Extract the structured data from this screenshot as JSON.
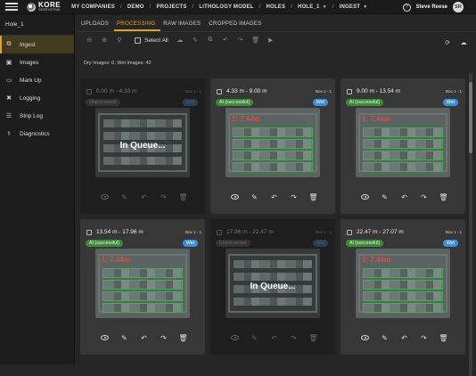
{
  "header": {
    "logo_text": "KORE",
    "logo_subtext": "GEOSYSTEMS",
    "breadcrumbs": [
      "MY COMPANIES",
      "DEMO",
      "PROJECTS",
      "LITHOLOGY MODEL",
      "HOLES",
      "HOLE_1",
      "INGEST"
    ],
    "user_name": "Steve Reese",
    "user_initials": "SR"
  },
  "sidebar": {
    "hole_name": "Hole_1",
    "items": [
      {
        "label": "Ingest",
        "icon": "crop-icon"
      },
      {
        "label": "Images",
        "icon": "images-icon"
      },
      {
        "label": "Mark Up",
        "icon": "markup-icon"
      },
      {
        "label": "Logging",
        "icon": "tools-icon"
      },
      {
        "label": "Strip Log",
        "icon": "striplog-icon"
      },
      {
        "label": "Diagnostics",
        "icon": "diagnostics-icon"
      }
    ]
  },
  "tabs": [
    "UPLOADS",
    "PROCESSING",
    "RAW IMAGES",
    "CROPPED IMAGES"
  ],
  "toolbar": {
    "select_all": "Select All"
  },
  "summary": "Dry Images: 0, Wet Images: 42",
  "cards": [
    {
      "range": "0.00 m - 4.33 m",
      "box": "Box 1 - 1",
      "status": "Unprocessed",
      "wet": "Wet",
      "queued": true,
      "queue_text": "In Queue..."
    },
    {
      "range": "4.33 m - 9.00 m",
      "box": "Box 1 - 1",
      "status": "AI (successful)",
      "wet": "Wet",
      "queued": false,
      "box_label": "1: 7.44m"
    },
    {
      "range": "9.00 m - 13.54 m",
      "box": "Box 1 - 1",
      "status": "AI (successful)",
      "wet": "Wet",
      "queued": false,
      "box_label": "1: 7.44m"
    },
    {
      "range": "13.54 m - 17.96 m",
      "box": "Box 1 - 1",
      "status": "AI (successful)",
      "wet": "Wet",
      "queued": false,
      "box_label": "1: 7.44m"
    },
    {
      "range": "17.96 m - 22.47 m",
      "box": "Box 1 - 1",
      "status": "Unprocessed",
      "wet": "Wet",
      "queued": true,
      "queue_text": "In Queue..."
    },
    {
      "range": "22.47 m - 27.07 m",
      "box": "Box 1 - 1",
      "status": "AI (successful)",
      "wet": "Wet",
      "queued": false,
      "box_label": "1: 7.44m"
    }
  ]
}
